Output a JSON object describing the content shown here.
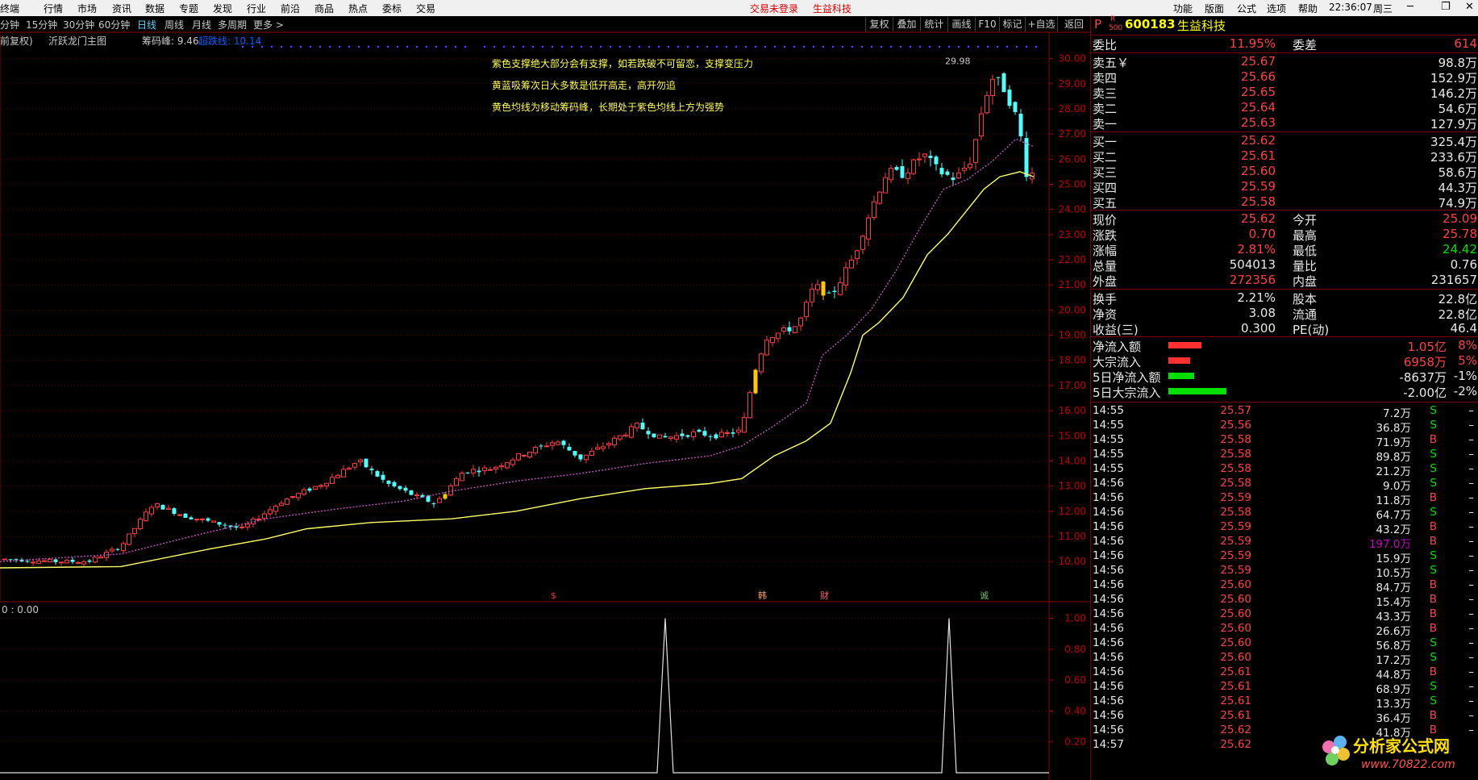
{
  "menu": {
    "items": [
      "终端",
      "行情",
      "市场",
      "资讯",
      "数据",
      "专题",
      "发现",
      "行业",
      "前沿",
      "商品",
      "热点",
      "委标",
      "交易"
    ],
    "status_login": "交易未登录",
    "status_stock": "生益科技",
    "right_items": [
      "功能",
      "版面",
      "公式",
      "选项",
      "帮助"
    ],
    "clock": "22:36:07",
    "weekday": "周三"
  },
  "periods": {
    "items": [
      "分钟",
      "15分钟",
      "30分钟",
      "60分钟",
      "日线",
      "周线",
      "月线",
      "多周期",
      "更多 >"
    ],
    "active": "日线"
  },
  "tools": [
    "复权",
    "叠加",
    "统计",
    "画线",
    "F10",
    "标记",
    "+自选",
    "返回"
  ],
  "chart": {
    "adjust_label": "前复权)",
    "indicator_name": "沂跃龙门主图",
    "chip_label": "筹码峰: 9.46",
    "chip2_label": "超跌线: 10.14",
    "peak_label": "29.98",
    "lower_label": "0 : 0.00",
    "annotations": [
      "紫色支撑绝大部分会有支撑，如若跌破不可留恋，支撑变压力",
      "黄蓝吸筹次日大多数是低开高走，高开勿追",
      "黄色均线为移动筹码峰，长期处于紫色均线上方为强势"
    ],
    "markers": [
      "$",
      "韩",
      "财",
      "诚"
    ]
  },
  "chart_data": {
    "type": "candlestick",
    "price_axis": [
      "30.00",
      "29.00",
      "28.00",
      "27.00",
      "26.00",
      "25.00",
      "24.00",
      "23.00",
      "22.00",
      "21.00",
      "20.00",
      "19.00",
      "18.00",
      "17.00",
      "16.00",
      "15.00",
      "14.00",
      "13.00",
      "12.00",
      "11.00",
      "10.00"
    ],
    "sub_axis": [
      "1.00",
      "0.80",
      "0.60",
      "0.40",
      "0.20"
    ],
    "ylim": [
      9.3,
      30.5
    ],
    "sub_ylim": [
      0,
      1.05
    ]
  },
  "quote": {
    "code": "600183",
    "name": "生益科技",
    "flag_p": "P",
    "flag_r": "R",
    "flag_500": "500",
    "webi_label": "委比",
    "webi_value": "11.95%",
    "weicha_label": "委差",
    "weicha_value": "614",
    "sell": [
      {
        "label": "卖五￥",
        "price": "25.67",
        "vol": "98.8万"
      },
      {
        "label": "卖四",
        "price": "25.66",
        "vol": "152.9万"
      },
      {
        "label": "卖三",
        "price": "25.65",
        "vol": "146.2万"
      },
      {
        "label": "卖二",
        "price": "25.64",
        "vol": "54.6万"
      },
      {
        "label": "卖一",
        "price": "25.63",
        "vol": "127.9万"
      }
    ],
    "buy": [
      {
        "label": "买一",
        "price": "25.62",
        "vol": "325.4万"
      },
      {
        "label": "买二",
        "price": "25.61",
        "vol": "233.6万"
      },
      {
        "label": "买三",
        "price": "25.60",
        "vol": "58.6万"
      },
      {
        "label": "买四",
        "price": "25.59",
        "vol": "44.3万"
      },
      {
        "label": "买五",
        "price": "25.58",
        "vol": "74.9万"
      }
    ],
    "stats": [
      {
        "l1": "现价",
        "v1": "25.62",
        "l2": "今开",
        "v2": "25.09"
      },
      {
        "l1": "涨跌",
        "v1": "0.70",
        "l2": "最高",
        "v2": "25.78"
      },
      {
        "l1": "涨幅",
        "v1": "2.81%",
        "l2": "最低",
        "v2": "24.42"
      },
      {
        "l1": "总量",
        "v1": "504013",
        "l2": "量比",
        "v2": "0.76"
      },
      {
        "l1": "外盘",
        "v1": "272356",
        "l2": "内盘",
        "v2": "231657"
      }
    ],
    "fin": [
      {
        "l1": "换手",
        "v1": "2.21%",
        "l2": "股本",
        "v2": "22.8亿"
      },
      {
        "l1": "净资",
        "v1": "3.08",
        "l2": "流通",
        "v2": "22.8亿"
      },
      {
        "l1": "收益(三)",
        "v1": "0.300",
        "l2": "PE(动)",
        "v2": "46.4"
      }
    ],
    "flows": [
      {
        "label": "净流入额",
        "value": "1.05亿",
        "pct": "8%",
        "bar": 0.45,
        "color": "#ff3030"
      },
      {
        "label": "大宗流入",
        "value": "6958万",
        "pct": "5%",
        "bar": 0.3,
        "color": "#ff3030"
      },
      {
        "label": "5日净流入额",
        "value": "-8637万",
        "pct": "-1%",
        "bar": 0.35,
        "color": "#00e000"
      },
      {
        "label": "5日大宗流入",
        "value": "-2.00亿",
        "pct": "-2%",
        "bar": 0.8,
        "color": "#00e000"
      }
    ]
  },
  "ticks": [
    [
      "14:55",
      "25.57",
      "7.2万",
      "S"
    ],
    [
      "14:55",
      "25.56",
      "36.8万",
      "S"
    ],
    [
      "14:55",
      "25.58",
      "71.9万",
      "B"
    ],
    [
      "14:55",
      "25.58",
      "89.8万",
      "S"
    ],
    [
      "14:55",
      "25.58",
      "21.2万",
      "S"
    ],
    [
      "14:56",
      "25.58",
      "9.0万",
      "S"
    ],
    [
      "14:56",
      "25.59",
      "11.8万",
      "B"
    ],
    [
      "14:56",
      "25.58",
      "64.7万",
      "S"
    ],
    [
      "14:56",
      "25.59",
      "43.2万",
      "B"
    ],
    [
      "14:56",
      "25.59",
      "197.0万",
      "B"
    ],
    [
      "14:56",
      "25.59",
      "15.9万",
      "S"
    ],
    [
      "14:56",
      "25.59",
      "10.5万",
      "S"
    ],
    [
      "14:56",
      "25.60",
      "84.7万",
      "B"
    ],
    [
      "14:56",
      "25.60",
      "15.4万",
      "B"
    ],
    [
      "14:56",
      "25.60",
      "43.3万",
      "B"
    ],
    [
      "14:56",
      "25.60",
      "26.6万",
      "B"
    ],
    [
      "14:56",
      "25.60",
      "56.8万",
      "S"
    ],
    [
      "14:56",
      "25.60",
      "17.2万",
      "S"
    ],
    [
      "14:56",
      "25.61",
      "44.8万",
      "B"
    ],
    [
      "14:56",
      "25.61",
      "68.9万",
      "S"
    ],
    [
      "14:56",
      "25.61",
      "13.3万",
      "S"
    ],
    [
      "14:56",
      "25.61",
      "36.4万",
      "B"
    ],
    [
      "14:56",
      "25.62",
      "41.8万",
      "B"
    ],
    [
      "14:57",
      "25.62",
      "",
      ""
    ]
  ],
  "tick_dash": "–",
  "watermark": {
    "text": "分析家公式网",
    "url": "www.70822.com"
  }
}
